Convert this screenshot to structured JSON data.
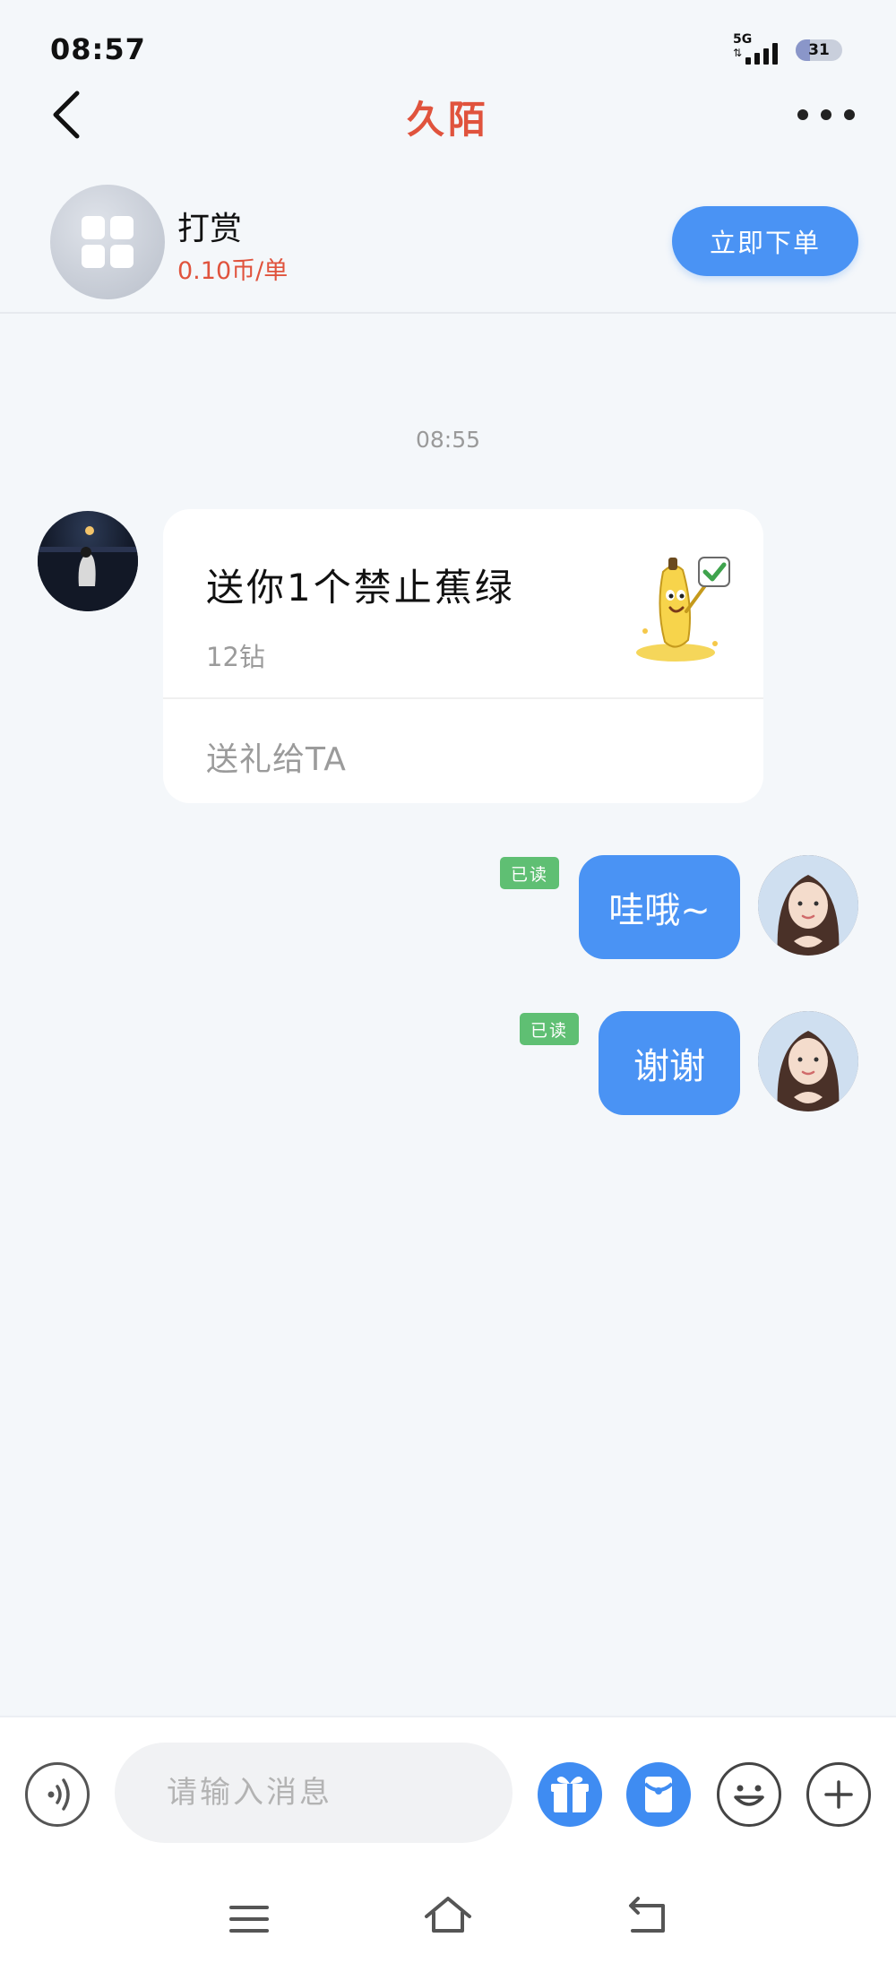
{
  "status_bar": {
    "time": "08:57",
    "network": "5G",
    "battery": "31",
    "battery_level_percent": 31
  },
  "header": {
    "title": "久陌",
    "back_icon": "chevron-left-icon",
    "more_icon": "more-horizontal-icon"
  },
  "service": {
    "name": "打赏",
    "price": "0.10币/单",
    "order_button": "立即下单",
    "icon": "apps-grid-icon"
  },
  "chat": {
    "timestamp": "08:55",
    "gift_message": {
      "title": "送你1个禁止蕉绿",
      "price": "12钻",
      "action": "送礼给TA",
      "image_icon": "banana-mascot-icon"
    },
    "messages": [
      {
        "text": "哇哦~",
        "status": "已读"
      },
      {
        "text": "谢谢",
        "status": "已读"
      }
    ]
  },
  "input_bar": {
    "placeholder": "请输入消息",
    "voice_icon": "voice-icon",
    "gift_icon": "gift-icon",
    "red_packet_icon": "red-packet-icon",
    "emoji_icon": "emoji-icon",
    "plus_icon": "plus-icon"
  },
  "nav_bar": {
    "menu_icon": "menu-icon",
    "home_icon": "home-icon",
    "back_icon": "back-icon"
  },
  "colors": {
    "accent_blue": "#4a93f4",
    "title_red": "#e0533d",
    "read_green": "#5fbf73",
    "background": "#f4f7fa"
  }
}
